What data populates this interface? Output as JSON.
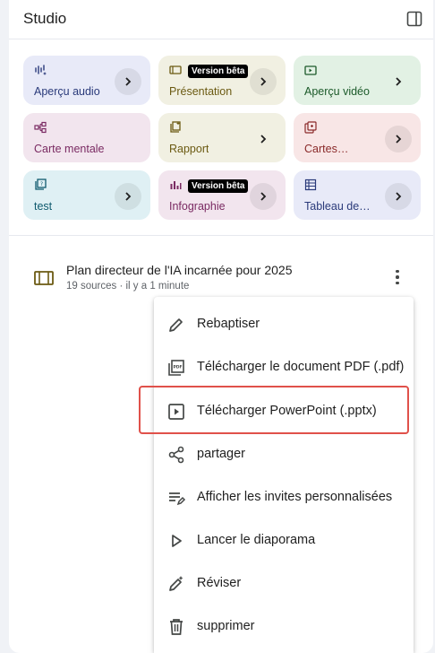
{
  "studio": {
    "title": "Studio",
    "panel_toggle_icon": "side-panel-icon"
  },
  "tiles": [
    {
      "label": "Aperçu audio",
      "icon": "audio-waveform-icon",
      "bg": "#e8eaf8",
      "color": "#2a3a7a",
      "badge": ""
    },
    {
      "label": "Présentation",
      "icon": "slides-icon",
      "bg": "#f1f0e2",
      "color": "#6b5a12",
      "badge": "Version bêta"
    },
    {
      "label": "Aperçu vidéo",
      "icon": "video-icon",
      "bg": "#e2f1e4",
      "color": "#1c5a2a",
      "badge": ""
    },
    {
      "label": "Carte mentale",
      "icon": "mind-map-icon",
      "bg": "#f2e5ee",
      "color": "#7a2a62",
      "badge": ""
    },
    {
      "label": "Rapport",
      "icon": "report-icon",
      "bg": "#f1f0e2",
      "color": "#6b5a12",
      "badge": ""
    },
    {
      "label": "Cartes…",
      "icon": "flashcards-icon",
      "bg": "#f8e6e6",
      "color": "#8a2a2a",
      "badge": ""
    },
    {
      "label": "test",
      "icon": "quiz-icon",
      "bg": "#dff0f4",
      "color": "#0f5a6e",
      "badge": ""
    },
    {
      "label": "Infographie",
      "icon": "infographic-icon",
      "bg": "#f2e5ee",
      "color": "#7a2a62",
      "badge": "Version bêta"
    },
    {
      "label": "Tableau de…",
      "icon": "table-icon",
      "bg": "#e8eaf8",
      "color": "#2a3a7a",
      "badge": ""
    }
  ],
  "note": {
    "title": "Plan directeur de l'IA incarnée pour 2025",
    "meta": "19 sources · il y a 1 minute"
  },
  "menu": [
    {
      "label": "Rebaptiser",
      "icon": "pencil-icon"
    },
    {
      "label": "Télécharger le document PDF (.pdf)",
      "icon": "pdf-icon"
    },
    {
      "label": "Télécharger PowerPoint (.pptx)",
      "icon": "play-box-icon"
    },
    {
      "label": "partager",
      "icon": "share-icon"
    },
    {
      "label": "Afficher les invites personnalisées",
      "icon": "prompt-list-icon"
    },
    {
      "label": "Lancer le diaporama",
      "icon": "play-icon"
    },
    {
      "label": "Réviser",
      "icon": "magic-pencil-icon"
    },
    {
      "label": "supprimer",
      "icon": "trash-icon"
    }
  ],
  "highlight_color": "#e0514a"
}
